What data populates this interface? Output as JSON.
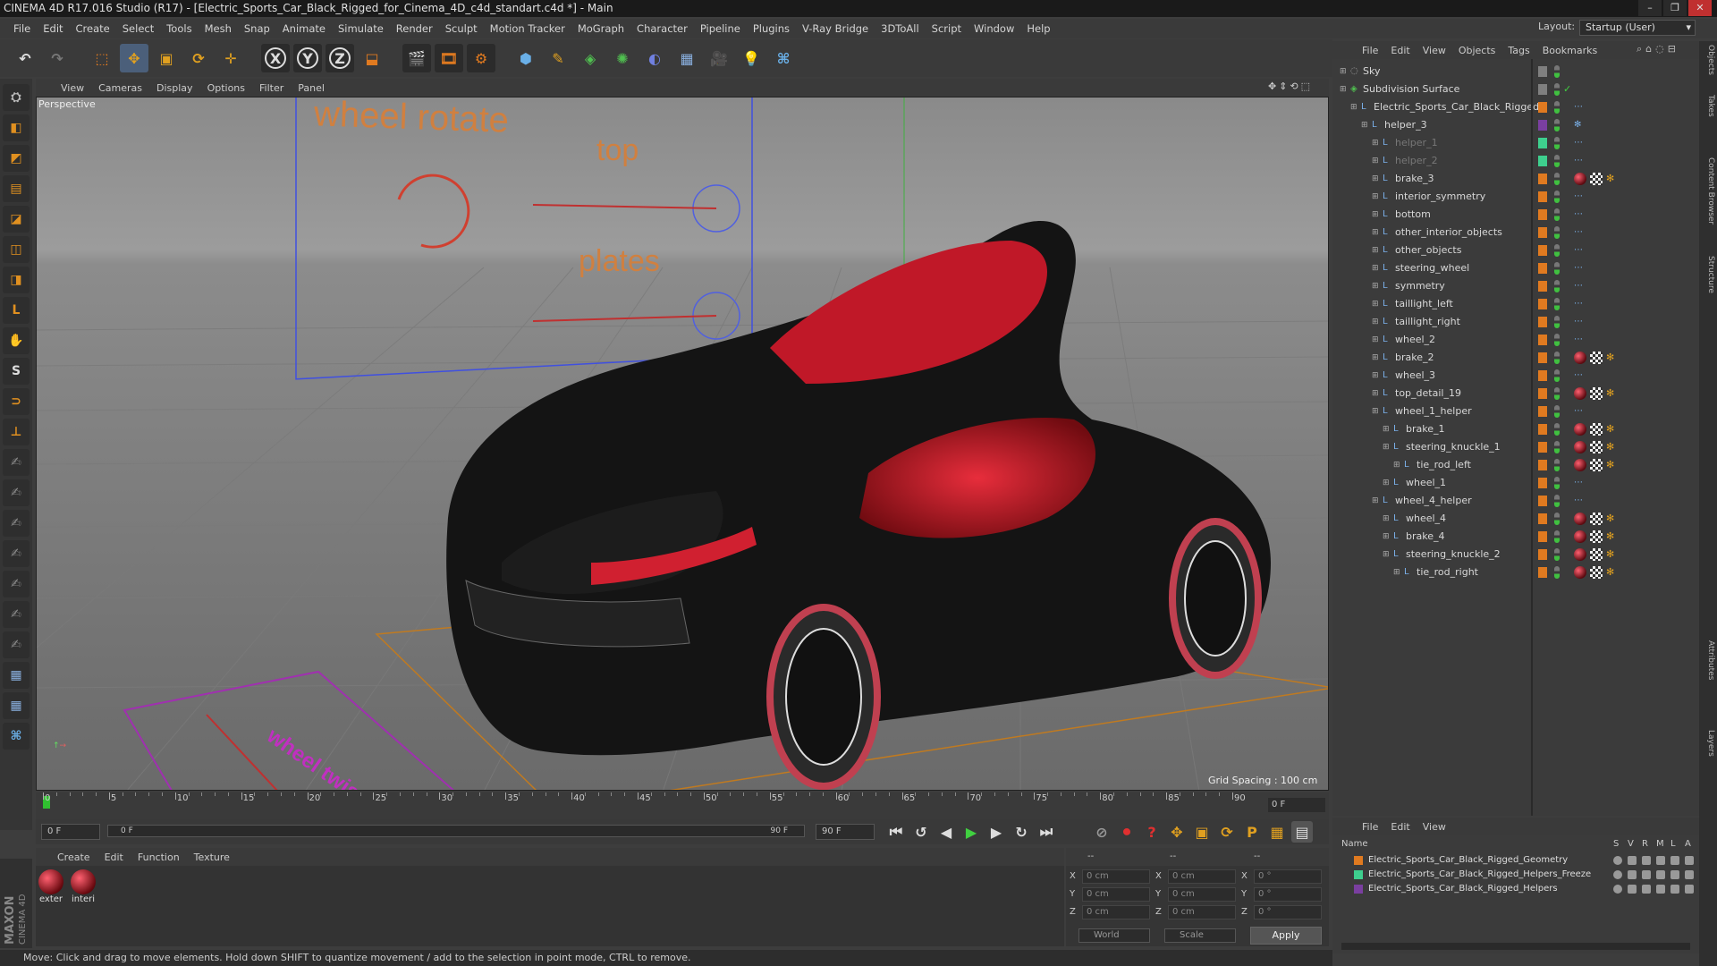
{
  "title": "CINEMA 4D R17.016 Studio (R17) - [Electric_Sports_Car_Black_Rigged_for_Cinema_4D_c4d_standart.c4d *] - Main",
  "window_controls": [
    "–",
    "❐",
    "✕"
  ],
  "menus": [
    "File",
    "Edit",
    "Create",
    "Select",
    "Tools",
    "Mesh",
    "Snap",
    "Animate",
    "Simulate",
    "Render",
    "Sculpt",
    "Motion Tracker",
    "MoGraph",
    "Character",
    "Pipeline",
    "Plugins",
    "V-Ray Bridge",
    "3DToAll",
    "Script",
    "Window",
    "Help"
  ],
  "layout": {
    "label": "Layout:",
    "value": "Startup (User)"
  },
  "toolbar": {
    "x": "X",
    "y": "Y",
    "z": "Z"
  },
  "viewport": {
    "menus": [
      "View",
      "Cameras",
      "Display",
      "Options",
      "Filter",
      "Panel"
    ],
    "camera": "Perspective",
    "grid_spacing": "Grid Spacing : 100 cm",
    "overlay_texts": {
      "wheel_rotate": "wheel rotate",
      "top": "top",
      "plates": "plates",
      "wheel_twist": "wheel twist"
    }
  },
  "timeline": {
    "ticks": [
      "0",
      "5",
      "10",
      "15",
      "20",
      "25",
      "30",
      "35",
      "40",
      "45",
      "50",
      "55",
      "60",
      "65",
      "70",
      "75",
      "80",
      "85",
      "90"
    ],
    "end_frame": "0 F"
  },
  "transport": {
    "start": "0 F",
    "slider_left": "0 F",
    "slider_right": "90 F",
    "end": "90 F"
  },
  "materials": {
    "menus": [
      "Create",
      "Edit",
      "Function",
      "Texture"
    ],
    "items": [
      {
        "name": "exter"
      },
      {
        "name": "interi"
      }
    ]
  },
  "coords": {
    "rows": [
      {
        "a": "X",
        "av": "0 cm",
        "b": "X",
        "bv": "0 cm",
        "c": "X",
        "cv": "0 °"
      },
      {
        "a": "Y",
        "av": "0 cm",
        "b": "Y",
        "bv": "0 cm",
        "c": "Y",
        "cv": "0 °"
      },
      {
        "a": "Z",
        "av": "0 cm",
        "b": "Z",
        "bv": "0 cm",
        "c": "Z",
        "cv": "0 °"
      }
    ],
    "world": "World",
    "scale": "Scale",
    "apply": "Apply",
    "header_left": "--",
    "header_mid": "--",
    "header_right": "--"
  },
  "objects": {
    "menus": [
      "File",
      "Edit",
      "View",
      "Objects",
      "Tags",
      "Bookmarks"
    ],
    "rows": [
      {
        "name": "Sky",
        "indent": 0,
        "color": "#7f7f7f",
        "dim": false
      },
      {
        "name": "Subdivision Surface",
        "indent": 0,
        "color": "#7f7f7f",
        "dim": false
      },
      {
        "name": "Electric_Sports_Car_Black_Rigged",
        "indent": 1,
        "color": "#e07a20",
        "dim": false
      },
      {
        "name": "helper_3",
        "indent": 2,
        "color": "#7a3fa0",
        "dim": false
      },
      {
        "name": "helper_1",
        "indent": 3,
        "color": "#3ecf8e",
        "dim": true
      },
      {
        "name": "helper_2",
        "indent": 3,
        "color": "#3ecf8e",
        "dim": true
      },
      {
        "name": "brake_3",
        "indent": 3,
        "color": "#e07a20",
        "dim": false
      },
      {
        "name": "interior_symmetry",
        "indent": 3,
        "color": "#e07a20",
        "dim": false
      },
      {
        "name": "bottom",
        "indent": 3,
        "color": "#e07a20",
        "dim": false
      },
      {
        "name": "other_interior_objects",
        "indent": 3,
        "color": "#e07a20",
        "dim": false
      },
      {
        "name": "other_objects",
        "indent": 3,
        "color": "#e07a20",
        "dim": false
      },
      {
        "name": "steering_wheel",
        "indent": 3,
        "color": "#e07a20",
        "dim": false
      },
      {
        "name": "symmetry",
        "indent": 3,
        "color": "#e07a20",
        "dim": false
      },
      {
        "name": "taillight_left",
        "indent": 3,
        "color": "#e07a20",
        "dim": false
      },
      {
        "name": "taillight_right",
        "indent": 3,
        "color": "#e07a20",
        "dim": false
      },
      {
        "name": "wheel_2",
        "indent": 3,
        "color": "#e07a20",
        "dim": false
      },
      {
        "name": "brake_2",
        "indent": 3,
        "color": "#e07a20",
        "dim": false
      },
      {
        "name": "wheel_3",
        "indent": 3,
        "color": "#e07a20",
        "dim": false
      },
      {
        "name": "top_detail_19",
        "indent": 3,
        "color": "#e07a20",
        "dim": false
      },
      {
        "name": "wheel_1_helper",
        "indent": 3,
        "color": "#e07a20",
        "dim": false
      },
      {
        "name": "brake_1",
        "indent": 4,
        "color": "#e07a20",
        "dim": false
      },
      {
        "name": "steering_knuckle_1",
        "indent": 4,
        "color": "#e07a20",
        "dim": false
      },
      {
        "name": "tie_rod_left",
        "indent": 5,
        "color": "#e07a20",
        "dim": false
      },
      {
        "name": "wheel_1",
        "indent": 4,
        "color": "#e07a20",
        "dim": false
      },
      {
        "name": "wheel_4_helper",
        "indent": 3,
        "color": "#e07a20",
        "dim": false
      },
      {
        "name": "wheel_4",
        "indent": 4,
        "color": "#e07a20",
        "dim": false
      },
      {
        "name": "brake_4",
        "indent": 4,
        "color": "#e07a20",
        "dim": false
      },
      {
        "name": "steering_knuckle_2",
        "indent": 4,
        "color": "#e07a20",
        "dim": false
      },
      {
        "name": "tie_rod_right",
        "indent": 5,
        "color": "#e07a20",
        "dim": false
      }
    ]
  },
  "layers": {
    "menus": [
      "File",
      "Edit",
      "View"
    ],
    "columns": {
      "name": "Name",
      "s": "S",
      "v": "V",
      "r": "R",
      "m": "M",
      "l": "L",
      "a": "A"
    },
    "rows": [
      {
        "name": "Electric_Sports_Car_Black_Rigged_Geometry",
        "color": "#e07a20"
      },
      {
        "name": "Electric_Sports_Car_Black_Rigged_Helpers_Freeze",
        "color": "#3ecf8e"
      },
      {
        "name": "Electric_Sports_Car_Black_Rigged_Helpers",
        "color": "#7a3fa0"
      }
    ]
  },
  "side_tabs": [
    "Objects",
    "Takes",
    "Content Browser",
    "Structure",
    "Attributes",
    "Layers"
  ],
  "status": "Move: Click and drag to move elements. Hold down SHIFT to quantize movement / add to the selection in point mode, CTRL to remove.",
  "logo": {
    "line1": "MAXON",
    "line2": "CINEMA 4D"
  }
}
